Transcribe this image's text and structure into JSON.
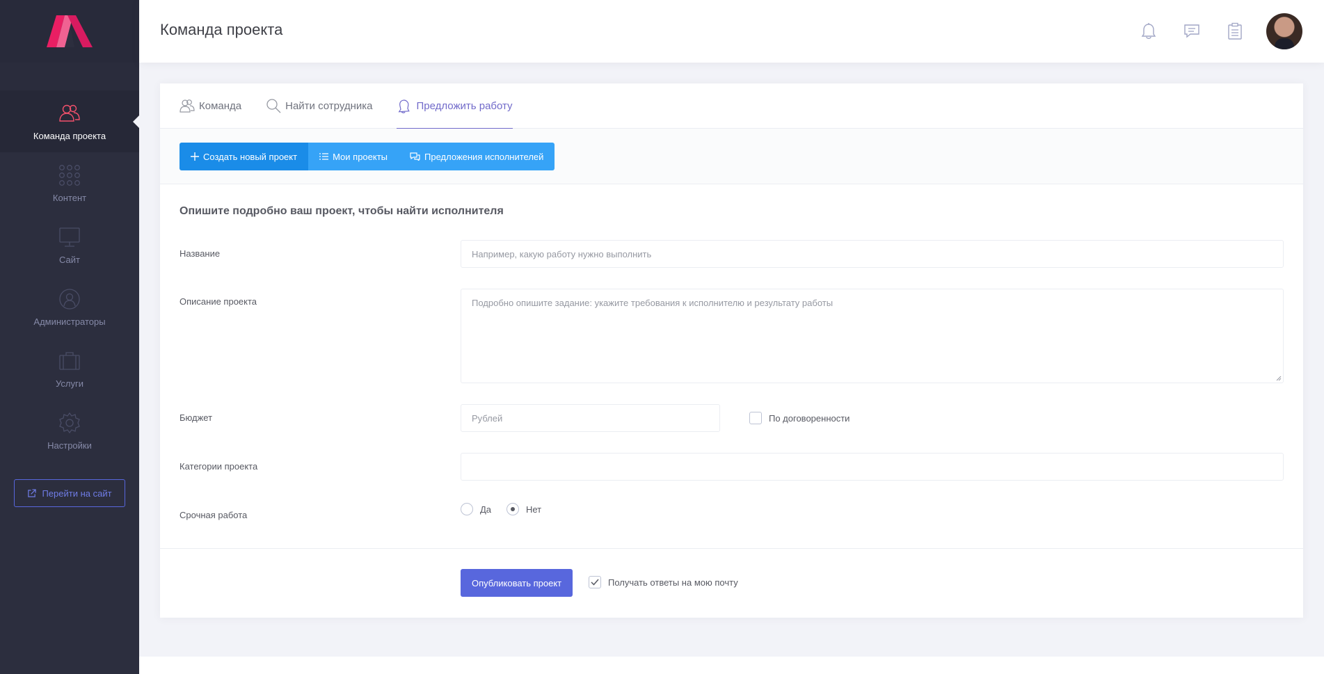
{
  "app": {
    "page_title": "Команда проекта"
  },
  "sidebar": {
    "items": [
      {
        "label": "Команда проекта",
        "icon": "users-icon",
        "active": true
      },
      {
        "label": "Контент",
        "icon": "grid-dots-icon",
        "active": false
      },
      {
        "label": "Сайт",
        "icon": "monitor-icon",
        "active": false
      },
      {
        "label": "Администраторы",
        "icon": "globe-user-icon",
        "active": false
      },
      {
        "label": "Услуги",
        "icon": "briefcase-icon",
        "active": false
      },
      {
        "label": "Настройки",
        "icon": "gear-icon",
        "active": false
      }
    ],
    "goto_site_label": "Перейти на сайт"
  },
  "tabs": [
    {
      "label": "Команда",
      "icon": "users-icon"
    },
    {
      "label": "Найти сотрудника",
      "icon": "search-icon"
    },
    {
      "label": "Предложить работу",
      "icon": "bell-icon",
      "active": true
    }
  ],
  "toolbar": {
    "create_label": "Создать новый проект",
    "my_projects_label": "Мои проекты",
    "offers_label": "Предложения исполнителей"
  },
  "form": {
    "heading": "Опишите подробно ваш проект, чтобы найти исполнителя",
    "name_label": "Название",
    "name_placeholder": "Например, какую работу нужно выполнить",
    "description_label": "Описание проекта",
    "description_placeholder": "Подробно опишите задание: укажите требования к исполнителю и результату работы",
    "budget_label": "Бюджет",
    "budget_placeholder": "Рублей",
    "negotiable_label": "По договоренности",
    "negotiable_checked": false,
    "categories_label": "Категории проекта",
    "urgent_label": "Срочная работа",
    "urgent_yes": "Да",
    "urgent_no": "Нет",
    "urgent_value": "Нет",
    "publish_label": "Опубликовать проект",
    "email_label": "Получать ответы на мою почту",
    "email_checked": true
  },
  "colors": {
    "sidebar_bg": "#2c2e3e",
    "accent": "#5867dd",
    "tab_active": "#716aca",
    "btn_primary": "#1a8ce8",
    "btn_info": "#36a3f7",
    "logo_pink": "#f4516c"
  }
}
